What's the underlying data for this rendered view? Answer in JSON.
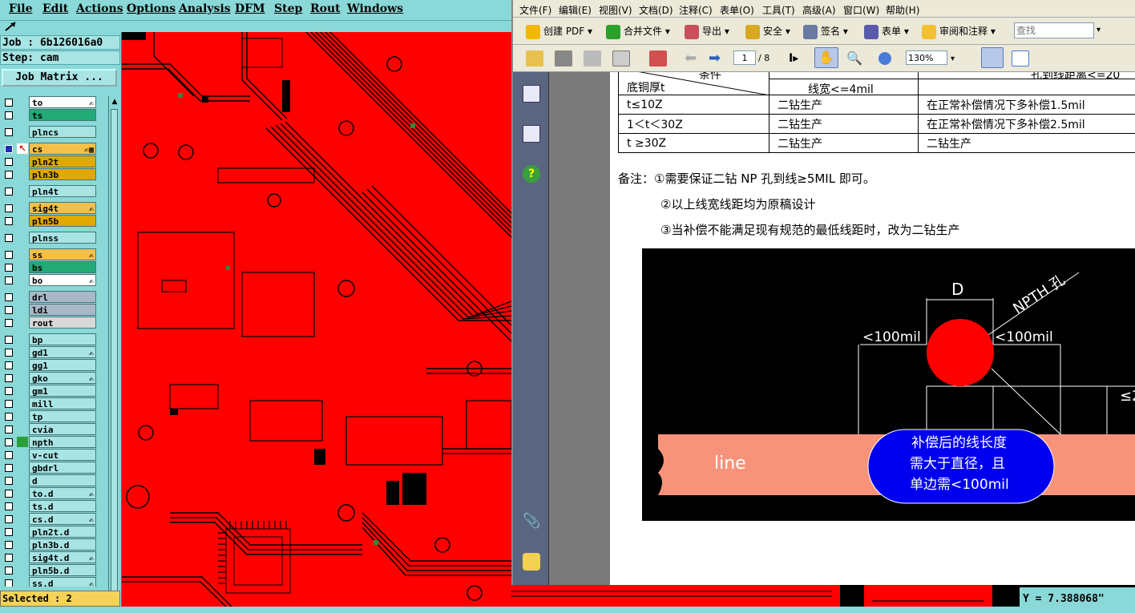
{
  "cam": {
    "menu": [
      "File",
      "Edit",
      "Actions",
      "Options",
      "Analysis",
      "DFM",
      "Step",
      "Rout",
      "Windows"
    ],
    "job_label": "Job : 6b126016a0",
    "step_label": "Step: cam",
    "job_matrix_button": "Job Matrix ...",
    "layers": [
      {
        "name": "to",
        "color": "#ffffff",
        "mark": "✍"
      },
      {
        "name": "ts",
        "color": "#22aa77",
        "mark": ""
      },
      {
        "name": "plncs",
        "color": "#a8e4e4",
        "mark": ""
      },
      {
        "name": "cs",
        "color": "#f5c04a",
        "mark": "✍▦",
        "active": true
      },
      {
        "name": "pln2t",
        "color": "#e0a800",
        "mark": ""
      },
      {
        "name": "pln3b",
        "color": "#e0a800",
        "mark": ""
      },
      {
        "name": "pln4t",
        "color": "#a8e4e4",
        "mark": ""
      },
      {
        "name": "sig4t",
        "color": "#f5c04a",
        "mark": "✍"
      },
      {
        "name": "pln5b",
        "color": "#e0a800",
        "mark": ""
      },
      {
        "name": "plnss",
        "color": "#a8e4e4",
        "mark": ""
      },
      {
        "name": "ss",
        "color": "#f5c04a",
        "mark": "✍"
      },
      {
        "name": "bs",
        "color": "#22aa77",
        "mark": ""
      },
      {
        "name": "bo",
        "color": "#ffffff",
        "mark": "✍"
      },
      {
        "name": "drl",
        "color": "#a8b8c8",
        "mark": ""
      },
      {
        "name": "ldi",
        "color": "#a8b8c8",
        "mark": ""
      },
      {
        "name": "rout",
        "color": "#d8d8d8",
        "mark": ""
      },
      {
        "name": "bp",
        "color": "#a8e4e4",
        "mark": ""
      },
      {
        "name": "gd1",
        "color": "#a8e4e4",
        "mark": "✍"
      },
      {
        "name": "gg1",
        "color": "#a8e4e4",
        "mark": ""
      },
      {
        "name": "gko",
        "color": "#a8e4e4",
        "mark": "✍"
      },
      {
        "name": "gm1",
        "color": "#a8e4e4",
        "mark": ""
      },
      {
        "name": "mill",
        "color": "#a8e4e4",
        "mark": ""
      },
      {
        "name": "tp",
        "color": "#a8e4e4",
        "mark": ""
      },
      {
        "name": "cvia",
        "color": "#a8e4e4",
        "mark": ""
      },
      {
        "name": "npth",
        "color": "#a8e4e4",
        "mark": "",
        "green": true
      },
      {
        "name": "v-cut",
        "color": "#a8e4e4",
        "mark": ""
      },
      {
        "name": "gbdrl",
        "color": "#a8e4e4",
        "mark": ""
      },
      {
        "name": "d",
        "color": "#a8e4e4",
        "mark": ""
      },
      {
        "name": "to.d",
        "color": "#a8e4e4",
        "mark": "✍"
      },
      {
        "name": "ts.d",
        "color": "#a8e4e4",
        "mark": ""
      },
      {
        "name": "cs.d",
        "color": "#a8e4e4",
        "mark": "✍"
      },
      {
        "name": "pln2t.d",
        "color": "#a8e4e4",
        "mark": ""
      },
      {
        "name": "pln3b.d",
        "color": "#a8e4e4",
        "mark": ""
      },
      {
        "name": "sig4t.d",
        "color": "#a8e4e4",
        "mark": "✍"
      },
      {
        "name": "pln5b.d",
        "color": "#a8e4e4",
        "mark": ""
      },
      {
        "name": "ss.d",
        "color": "#a8e4e4",
        "mark": "✍"
      }
    ],
    "selected_label": "Selected : 2",
    "coord_y": "Y = 7.388068\""
  },
  "reader": {
    "menu": [
      "文件(F)",
      "编辑(E)",
      "视图(V)",
      "文档(D)",
      "注释(C)",
      "表单(O)",
      "工具(T)",
      "高级(A)",
      "窗口(W)",
      "帮助(H)"
    ],
    "toolbar": [
      {
        "label": "创建 PDF",
        "icon": "create-pdf-icon"
      },
      {
        "label": "合并文件",
        "icon": "merge-icon"
      },
      {
        "label": "导出",
        "icon": "export-icon"
      },
      {
        "label": "安全",
        "icon": "lock-icon"
      },
      {
        "label": "签名",
        "icon": "pen-icon"
      },
      {
        "label": "表单",
        "icon": "form-icon"
      },
      {
        "label": "审阅和注释",
        "icon": "comment-icon"
      }
    ],
    "search_placeholder": "查找",
    "page_current": "1",
    "page_total": "/ 8",
    "zoom": "130%",
    "table": {
      "head_condition": "条件",
      "head_base": "底铜厚t",
      "head_linewidth": "线宽<=4mil",
      "head_distance": "孔到线距离<=20",
      "rows": [
        [
          "t≤10Z",
          "二钻生产",
          "在正常补偿情况下多补偿1.5mil"
        ],
        [
          "1＜t＜30Z",
          "二钻生产",
          "在正常补偿情况下多补偿2.5mil"
        ],
        [
          "t ≥30Z",
          "二钻生产",
          "二钻生产"
        ]
      ]
    },
    "notes": [
      "备注：①需要保证二钻 NP 孔到线≥5MIL 即可。",
      "②以上线宽线距均为原稿设计",
      "③当补偿不能满足现有规范的最低线距时，改为二钻生产"
    ],
    "diagram": {
      "label_d": "D",
      "label_npth": "NPTH 孔",
      "label_left": "<100mil",
      "label_right": "<100mil",
      "label_le2": "≤2",
      "label_line": "line",
      "bubble": [
        "补偿后的线长度",
        "需大于直径，且",
        "单边需<100mil"
      ]
    }
  }
}
